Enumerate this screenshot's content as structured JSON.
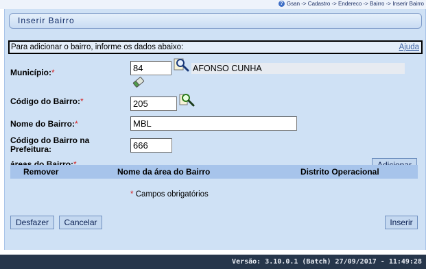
{
  "breadcrumb": {
    "text": "Gsan -> Cadastro -> Endereco -> Bairro -> Inserir Bairro"
  },
  "title": "Inserir Bairro",
  "info": {
    "text": "Para adicionar o bairro, informe os dados abaixo:",
    "help_link": "Ajuda"
  },
  "form": {
    "municipio": {
      "label": "Município:",
      "required_mark": "*",
      "code": "84",
      "name": "AFONSO CUNHA"
    },
    "codigo_bairro": {
      "label": "Código do Bairro:",
      "required_mark": "*",
      "value": "205"
    },
    "nome_bairro": {
      "label": "Nome do Bairro:",
      "required_mark": "*",
      "value": "MBL"
    },
    "codigo_prefeitura": {
      "label_line1": "Código do Bairro na",
      "label_line2": "Prefeitura:",
      "value": "666"
    },
    "areas": {
      "label": "áreas do Bairro:",
      "required_mark": "*",
      "add_button": "Adicionar"
    }
  },
  "grid": {
    "columns": [
      "Remover",
      "Nome da área do Bairro",
      "Distrito Operacional"
    ]
  },
  "required_note": {
    "mark": "*",
    "text": "Campos obrigatórios"
  },
  "buttons": {
    "desfazer": "Desfazer",
    "cancelar": "Cancelar",
    "inserir": "Inserir"
  },
  "footer": {
    "version": "Versão: 3.10.0.1 (Batch) 27/09/2017 - 11:49:28"
  },
  "icons": {
    "breadcrumb_help": "question-icon",
    "municipio_search": "magnifier-icon",
    "municipio_clear": "eraser-icon",
    "bairro_search": "magnifier-icon"
  }
}
